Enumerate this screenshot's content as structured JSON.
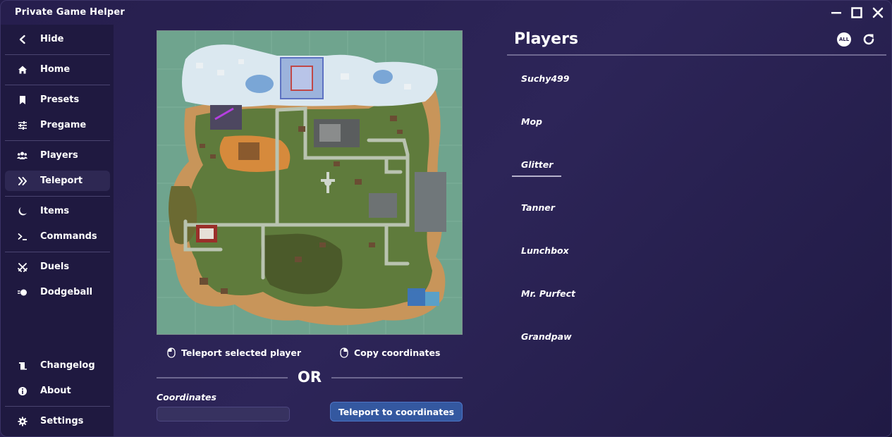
{
  "app": {
    "title": "Private Game Helper"
  },
  "sidebar": {
    "items": [
      {
        "label": "Hide",
        "icon": "chevron-left-icon"
      },
      {
        "label": "Home",
        "icon": "home-icon"
      },
      {
        "label": "Presets",
        "icon": "bookmark-icon"
      },
      {
        "label": "Pregame",
        "icon": "sliders-icon"
      },
      {
        "label": "Players",
        "icon": "users-icon"
      },
      {
        "label": "Teleport",
        "icon": "double-chevron-right-icon"
      },
      {
        "label": "Items",
        "icon": "moon-icon"
      },
      {
        "label": "Commands",
        "icon": "terminal-icon"
      },
      {
        "label": "Duels",
        "icon": "crossed-swords-icon"
      },
      {
        "label": "Dodgeball",
        "icon": "ball-icon"
      },
      {
        "label": "Changelog",
        "icon": "scroll-icon"
      },
      {
        "label": "About",
        "icon": "info-icon"
      },
      {
        "label": "Settings",
        "icon": "gear-icon"
      }
    ],
    "active": "Teleport"
  },
  "teleport": {
    "action_teleport_label": "Teleport selected player",
    "action_copy_label": "Copy coordinates",
    "or_label": "OR",
    "coordinates_label": "Coordinates",
    "coordinates_value": "",
    "teleport_button_label": "Teleport to coordinates"
  },
  "players_panel": {
    "title": "Players",
    "all_label": "ALL",
    "players": [
      "Suchy499",
      "Mop",
      "Glitter",
      "Tanner",
      "Lunchbox",
      "Mr. Purfect",
      "Grandpaw"
    ],
    "selected": "Glitter"
  },
  "colors": {
    "background": "#2a2253",
    "sidebar": "#1f1940",
    "active_nav": "#2e2853",
    "accent_button": "#3458a0",
    "map_water": "#6fa48e"
  }
}
